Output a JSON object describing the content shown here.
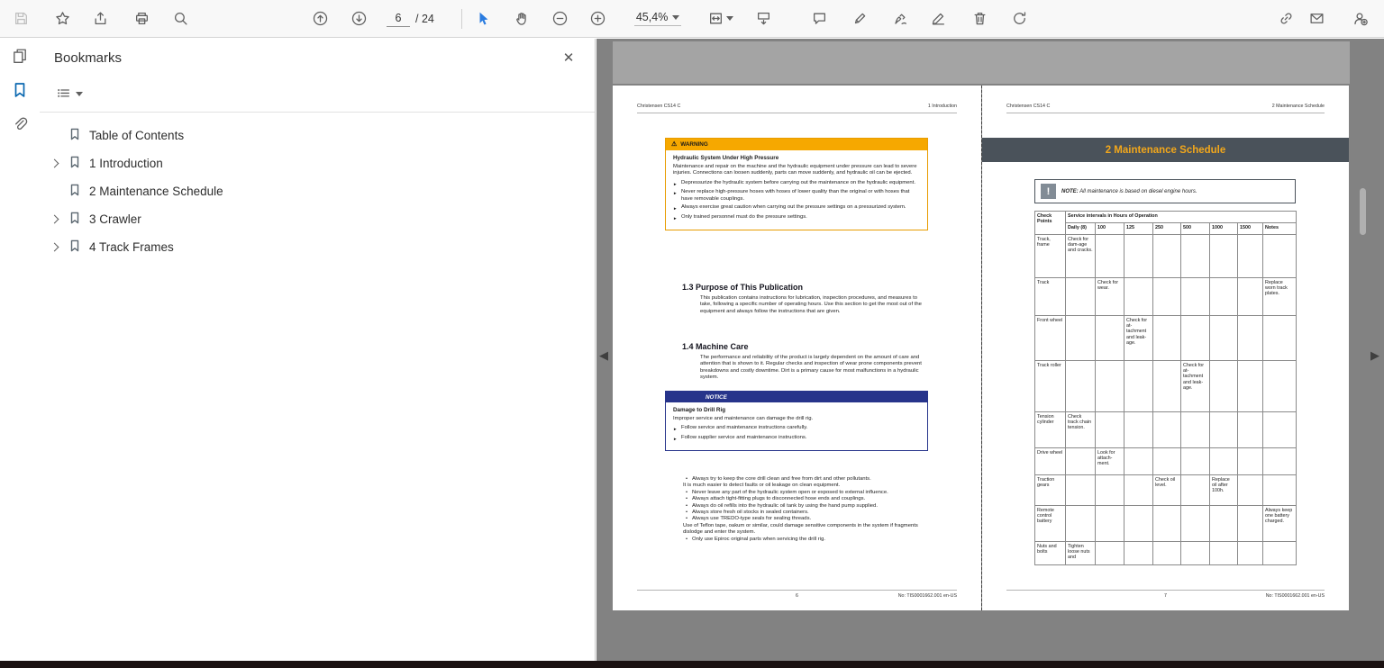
{
  "icons": {
    "warning_glyph": "⚠",
    "close_glyph": "✕",
    "note_glyph": "!",
    "arrow_bullet": "►",
    "dot_bullet": "•",
    "nav_prev": "◀",
    "nav_next": "▶"
  },
  "toolbar": {
    "page_current": "6",
    "page_total_label": "/ 24",
    "zoom_level": "45,4%"
  },
  "bookmarks_panel": {
    "title": "Bookmarks",
    "items": [
      {
        "label": "Table of Contents"
      },
      {
        "label": "1 Introduction"
      },
      {
        "label": "2 Maintenance Schedule"
      },
      {
        "label": "3 Crawler"
      },
      {
        "label": "4 Track Frames"
      }
    ]
  },
  "page_left": {
    "header_left": "Christensen CS14 C",
    "header_right": "1 Introduction",
    "warning": {
      "title": "WARNING",
      "subtitle": "Hydraulic System Under High Pressure",
      "body": "Maintenance and repair on the machine and the hydraulic equipment under pressure can lead to severe injuries. Connections can loosen suddenly, parts can move suddenly, and hydraulic oil can be ejected.",
      "bullets": [
        "Depressurize the hydraulic system before carrying out the maintenance on the hydraulic equipment.",
        "Never replace high-pressure hoses with hoses of lower quality than the original or with hoses that have removable couplings.",
        "Always exercise great caution when carrying out the pressure settings on a pressurized system.",
        "Only trained personnel must do the pressure settings."
      ]
    },
    "section_13_title": "1.3  Purpose of This Publication",
    "section_13_body": "This publication contains instructions for lubrication, inspection procedures, and measures to take, following a specific number of operating hours. Use this section to get the most out of the equipment and always follow the instructions that are given.",
    "section_14_title": "1.4  Machine Care",
    "section_14_body": "The performance and reliability of the product is largely dependent on the amount of care and attention that is shown to it. Regular checks and inspection of wear prone components prevent breakdowns and costly downtime. Dirt is a primary cause for most malfunctions in a hydraulic system.",
    "notice": {
      "title": "NOTICE",
      "subtitle": "Damage to Drill Rig",
      "body": "Improper service and maintenance can damage the drill rig.",
      "bullets": [
        "Follow service and maintenance instructions carefully.",
        "Follow supplier service and maintenance instructions."
      ]
    },
    "care_items": [
      "Always try to keep the core drill clean and free from dirt and other pollutants.",
      "It is much easier to detect faults or oil leakage on clean equipment.",
      "Never leave any part of the hydraulic system open or exposed to external influence.",
      "Always attach tight-fitting plugs to disconnected hose ends and couplings.",
      "Always do oil refills into the hydraulic oil tank by using the hand pump supplied.",
      "Always store fresh oil stocks in sealed containers.",
      "Always use TREDO-type seals for sealing threads.",
      "Use of Teflon tape, oakum or similar, could damage sensitive components in the system if fragments dislodge and enter the system.",
      "Only use Epiroc original parts when servicing the drill rig."
    ],
    "footer_page_number": "6",
    "footer_doc_number": "No: TIS0001662.001 en-US"
  },
  "page_right": {
    "header_left": "Christensen CS14 C",
    "header_right": "2 Maintenance Schedule",
    "banner_title": "2 Maintenance Schedule",
    "note_label": "NOTE:",
    "note_text": " All maintenance is based on diesel engine hours.",
    "table": {
      "corner_header": "Check Points",
      "span_header": "Service intervals in Hours of Operation",
      "columns": [
        "Daily (8)",
        "100",
        "125",
        "250",
        "500",
        "1000",
        "1500",
        "Notes"
      ],
      "rows": [
        {
          "check": "Track, frame",
          "cells": [
            "Check for dam-age and cracks.",
            "",
            "",
            "",
            "",
            "",
            "",
            ""
          ]
        },
        {
          "check": "Track",
          "cells": [
            "",
            "Check for wear.",
            "",
            "",
            "",
            "",
            "",
            "Replace worn track plates."
          ]
        },
        {
          "check": "Front wheel",
          "cells": [
            "",
            "",
            "Check for at-tachment and leak-age.",
            "",
            "",
            "",
            "",
            ""
          ]
        },
        {
          "check": "Track roller",
          "cells": [
            "",
            "",
            "",
            "",
            "Check for at-tachment and leak-age.",
            "",
            "",
            ""
          ]
        },
        {
          "check": "Tension cylinder",
          "cells": [
            "Check track chain tension.",
            "",
            "",
            "",
            "",
            "",
            "",
            ""
          ]
        },
        {
          "check": "Drive wheel",
          "cells": [
            "",
            "Look for attach-ment.",
            "",
            "",
            "",
            "",
            "",
            ""
          ]
        },
        {
          "check": "Traction gears",
          "cells": [
            "",
            "",
            "",
            "Check oil level.",
            "",
            "Replace oil after 100h.",
            "",
            ""
          ]
        },
        {
          "check": "Remote control battery",
          "cells": [
            "",
            "",
            "",
            "",
            "",
            "",
            "",
            "Always keep one battery charged."
          ]
        },
        {
          "check": "Nuts and bolts",
          "cells": [
            "Tighten loose nuts and",
            "",
            "",
            "",
            "",
            "",
            "",
            ""
          ]
        }
      ]
    },
    "footer_page_number": "7",
    "footer_doc_number": "No: TIS0001662.001 en-US"
  }
}
